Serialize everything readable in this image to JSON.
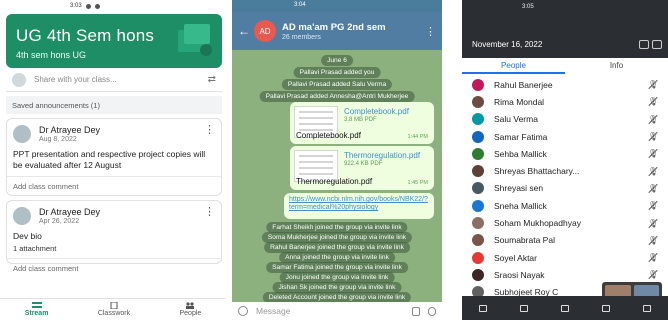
{
  "classroom": {
    "status_time": "3:03",
    "class_title": "UG 4th Sem hons",
    "class_subtitle": "4th sem hons UG",
    "share_placeholder": "Share with your class...",
    "saved_label": "Saved announcements (1)",
    "posts": [
      {
        "author": "Dr Atrayee Dey",
        "date": "Aug 8, 2022",
        "text": "PPT presentation and respective project copies will be evaluated after 12 August",
        "attachment": "",
        "comment": "Add class comment"
      },
      {
        "author": "Dr Atrayee Dey",
        "date": "Apr 26, 2022",
        "text": "Dev bio",
        "attachment": "1 attachment",
        "comment": "Add class comment"
      }
    ],
    "nav": {
      "stream": "Stream",
      "classwork": "Classwork",
      "people": "People"
    },
    "accent": "#1e8e66"
  },
  "telegram": {
    "status_time": "3:04",
    "avatar_initials": "AD",
    "group_name": "AD ma'am PG 2nd sem",
    "member_count": "26 members",
    "service_top": [
      "June 6",
      "Pallavi Prasad added you",
      "Pallavi Prasad added Salu Verma",
      "Pallavi Prasad added Annesha@Antri Mukherjee"
    ],
    "files": [
      {
        "name": "Completebook.pdf",
        "size": "3.8 MB PDF",
        "caption": "Completebook.pdf",
        "time": "1:44 PM"
      },
      {
        "name": "Thermoregulation.pdf",
        "size": "922.4 KB PDF",
        "caption": "Thermoregulation.pdf",
        "time": "1:45 PM"
      }
    ],
    "link_text": "https://www.ncbi.nlm.nih.gov/books/NBK22/?term=medical%20physiology",
    "service_bottom": [
      "Farhat Sheikh joined the group via invite link",
      "Soma Mukherjee joined the group via invite link",
      "Rahul Banerjee joined the group via invite link",
      "Anna joined the group via invite link",
      "Samar Fatima joined the group via invite link",
      "Jonu joined the group via invite link",
      "Jishan Sk joined the group via invite link",
      "Deleted Account joined the group via invite link"
    ],
    "input_placeholder": "Message",
    "header_color": "#527da3"
  },
  "participants": {
    "status_time": "3:05",
    "date": "November 16, 2022",
    "tabs": [
      "People",
      "Info"
    ],
    "people": [
      {
        "name": "Rahul Banerjee",
        "color": "#c2185b"
      },
      {
        "name": "Rima Mondal",
        "color": "#6d4c41"
      },
      {
        "name": "Salu Verma",
        "color": "#0097a7"
      },
      {
        "name": "Samar Fatima",
        "color": "#1565c0"
      },
      {
        "name": "Sehba Mallick",
        "color": "#2e7d32"
      },
      {
        "name": "Shreyas Bhattachary...",
        "color": "#5d4037"
      },
      {
        "name": "Shreyasi sen",
        "color": "#455a64"
      },
      {
        "name": "Sneha Mallick",
        "color": "#1976d2"
      },
      {
        "name": "Soham Mukhopadhyay",
        "color": "#8d6e63"
      },
      {
        "name": "Soumabrata Pal",
        "color": "#795548"
      },
      {
        "name": "Soyel Aktar",
        "color": "#e53935"
      },
      {
        "name": "Sraosi Nayak",
        "color": "#3e2723"
      },
      {
        "name": "Subhojeet Roy C",
        "color": "#616161"
      }
    ]
  }
}
